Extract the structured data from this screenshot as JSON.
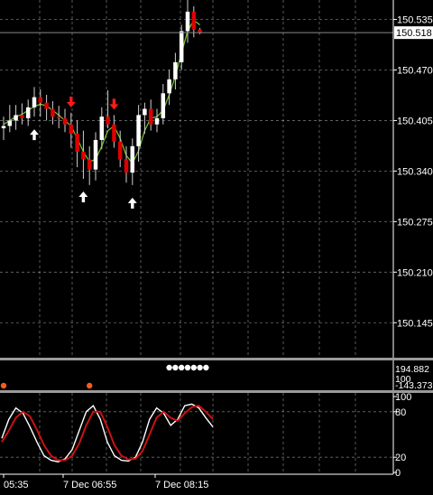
{
  "colors": {
    "background": "#000000",
    "grid": "#c8c8c8",
    "axis": "#ffffff",
    "bull_candle": "#ffffff",
    "bear_candle": "#dd0000",
    "wick": "#cfcfcf",
    "ma_line": "#6fbf2a",
    "arrow_up": "#ffffff",
    "arrow_down": "#ff1a1a",
    "current_price_line": "#8a8a8a",
    "current_price_box": "#ffffff",
    "pane_separator": "#9a9a9a",
    "dot_white": "#ffffff",
    "dot_orange": "#ff5a1a",
    "stoch_main": "#ffffff",
    "stoch_signal": "#cc1111"
  },
  "chart_data": [
    {
      "type": "candlestick",
      "pane": "price",
      "ylim": [
        150.1,
        150.56
      ],
      "y_ticks": [
        "150.535",
        "150.470",
        "150.405",
        "150.340",
        "150.275",
        "150.210",
        "150.145"
      ],
      "current_price": "150.518",
      "candles": [
        {
          "o": 150.395,
          "h": 150.41,
          "l": 150.38,
          "c": 150.398
        },
        {
          "o": 150.398,
          "h": 150.425,
          "l": 150.39,
          "c": 150.405
        },
        {
          "o": 150.405,
          "h": 150.425,
          "l": 150.393,
          "c": 150.412
        },
        {
          "o": 150.412,
          "h": 150.427,
          "l": 150.4,
          "c": 150.408
        },
        {
          "o": 150.408,
          "h": 150.432,
          "l": 150.398,
          "c": 150.422
        },
        {
          "o": 150.422,
          "h": 150.448,
          "l": 150.41,
          "c": 150.435
        },
        {
          "o": 150.435,
          "h": 150.445,
          "l": 150.41,
          "c": 150.428
        },
        {
          "o": 150.428,
          "h": 150.438,
          "l": 150.405,
          "c": 150.42
        },
        {
          "o": 150.42,
          "h": 150.43,
          "l": 150.4,
          "c": 150.41
        },
        {
          "o": 150.41,
          "h": 150.424,
          "l": 150.395,
          "c": 150.408
        },
        {
          "o": 150.408,
          "h": 150.42,
          "l": 150.39,
          "c": 150.4
        },
        {
          "o": 150.4,
          "h": 150.415,
          "l": 150.37,
          "c": 150.388
        },
        {
          "o": 150.388,
          "h": 150.405,
          "l": 150.345,
          "c": 150.365
        },
        {
          "o": 150.365,
          "h": 150.392,
          "l": 150.33,
          "c": 150.355
        },
        {
          "o": 150.355,
          "h": 150.372,
          "l": 150.322,
          "c": 150.342
        },
        {
          "o": 150.342,
          "h": 150.39,
          "l": 150.328,
          "c": 150.38
        },
        {
          "o": 150.38,
          "h": 150.422,
          "l": 150.368,
          "c": 150.41
        },
        {
          "o": 150.41,
          "h": 150.444,
          "l": 150.395,
          "c": 150.4
        },
        {
          "o": 150.4,
          "h": 150.412,
          "l": 150.37,
          "c": 150.378
        },
        {
          "o": 150.378,
          "h": 150.392,
          "l": 150.345,
          "c": 150.355
        },
        {
          "o": 150.355,
          "h": 150.372,
          "l": 150.325,
          "c": 150.338
        },
        {
          "o": 150.338,
          "h": 150.382,
          "l": 150.322,
          "c": 150.372
        },
        {
          "o": 150.372,
          "h": 150.425,
          "l": 150.352,
          "c": 150.412
        },
        {
          "o": 150.412,
          "h": 150.428,
          "l": 150.388,
          "c": 150.42
        },
        {
          "o": 150.42,
          "h": 150.432,
          "l": 150.392,
          "c": 150.4
        },
        {
          "o": 150.4,
          "h": 150.42,
          "l": 150.39,
          "c": 150.408
        },
        {
          "o": 150.408,
          "h": 150.452,
          "l": 150.4,
          "c": 150.44
        },
        {
          "o": 150.44,
          "h": 150.47,
          "l": 150.425,
          "c": 150.458
        },
        {
          "o": 150.458,
          "h": 150.492,
          "l": 150.445,
          "c": 150.48
        },
        {
          "o": 150.48,
          "h": 150.528,
          "l": 150.47,
          "c": 150.52
        },
        {
          "o": 150.52,
          "h": 150.56,
          "l": 150.505,
          "c": 150.545
        },
        {
          "o": 150.545,
          "h": 150.552,
          "l": 150.512,
          "c": 150.522
        },
        {
          "o": 150.522,
          "h": 150.524,
          "l": 150.516,
          "c": 150.518
        }
      ],
      "ma_values": [
        150.4,
        150.405,
        150.41,
        150.413,
        150.418,
        150.423,
        150.426,
        150.424,
        150.418,
        150.412,
        150.405,
        150.398,
        150.382,
        150.365,
        150.352,
        150.355,
        150.372,
        150.392,
        150.398,
        150.382,
        150.36,
        150.35,
        150.366,
        150.392,
        150.408,
        150.41,
        150.418,
        150.438,
        150.462,
        150.492,
        150.52,
        150.534,
        150.528
      ],
      "arrows": [
        {
          "index": 5,
          "dir": "up"
        },
        {
          "index": 13,
          "dir": "up"
        },
        {
          "index": 21,
          "dir": "up"
        },
        {
          "index": 11,
          "dir": "down"
        },
        {
          "index": 18,
          "dir": "down"
        }
      ]
    },
    {
      "type": "scatter",
      "pane": "dots_indicator",
      "y_ticks": [
        "194.882",
        "100",
        "-143.373"
      ],
      "dots": [
        {
          "index": 0,
          "color": "orange",
          "row": "bottom"
        },
        {
          "index": 14,
          "color": "orange",
          "row": "bottom"
        },
        {
          "index": 27,
          "color": "white",
          "row": "top"
        },
        {
          "index": 28,
          "color": "white",
          "row": "top"
        },
        {
          "index": 29,
          "color": "white",
          "row": "top"
        },
        {
          "index": 30,
          "color": "white",
          "row": "top"
        },
        {
          "index": 31,
          "color": "white",
          "row": "top"
        },
        {
          "index": 32,
          "color": "white",
          "row": "top"
        },
        {
          "index": 33,
          "color": "white",
          "row": "top"
        }
      ]
    },
    {
      "type": "line",
      "pane": "stochastic",
      "ylim": [
        0,
        100
      ],
      "y_ticks": [
        "100",
        "80",
        "20",
        "0"
      ],
      "series": [
        {
          "values": [
            45,
            70,
            85,
            78,
            60,
            40,
            22,
            16,
            14,
            18,
            30,
            55,
            80,
            88,
            70,
            40,
            22,
            16,
            15,
            20,
            40,
            70,
            85,
            78,
            62,
            70,
            88,
            90,
            85,
            72,
            60
          ]
        },
        {
          "values": [
            40,
            55,
            72,
            80,
            74,
            56,
            36,
            22,
            16,
            16,
            22,
            38,
            62,
            80,
            80,
            60,
            36,
            22,
            17,
            18,
            28,
            50,
            72,
            80,
            72,
            68,
            78,
            86,
            88,
            80,
            70
          ]
        }
      ]
    }
  ],
  "time_axis": {
    "labels": [
      "05:35",
      "7 Dec 06:55",
      "7 Dec 08:15"
    ]
  }
}
